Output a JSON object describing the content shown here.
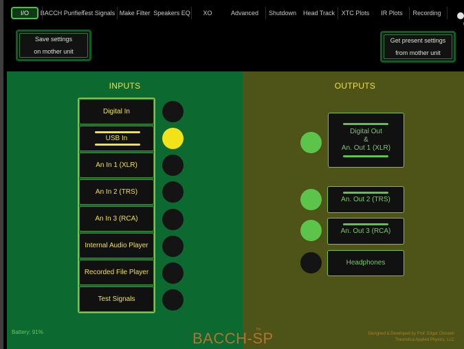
{
  "tabs": [
    {
      "label": "I/O",
      "active": true
    },
    {
      "label": "BACCH Purifier"
    },
    {
      "label": "Test Signals"
    },
    {
      "label": "Make Filter"
    },
    {
      "label": "Speakers EQ"
    },
    {
      "label": "XO"
    },
    {
      "label": "Advanced"
    },
    {
      "label": "Shutdown"
    },
    {
      "label": "Head Track"
    },
    {
      "label": "XTC Plots"
    },
    {
      "label": "IR Plots"
    },
    {
      "label": "Recording"
    }
  ],
  "corner_text": "0",
  "settings": {
    "save_line1": "Save settings",
    "save_line2": "on mother unit",
    "get_line1": "Get present settings",
    "get_line2": "from mother unit"
  },
  "inputs": {
    "title": "INPUTS",
    "items": [
      {
        "label": "Digital In",
        "selected": false
      },
      {
        "label": "USB In",
        "selected": true
      },
      {
        "label": "An In 1 (XLR)",
        "selected": false
      },
      {
        "label": "An In 2 (TRS)",
        "selected": false
      },
      {
        "label": "An In 3 (RCA)",
        "selected": false
      },
      {
        "label": "Internal Audio Player",
        "selected": false
      },
      {
        "label": "Recorded File Player",
        "selected": false
      },
      {
        "label": "Test Signals",
        "selected": false
      }
    ]
  },
  "outputs": {
    "title": "OUTPUTS",
    "items": [
      {
        "line1": "Digital Out",
        "line2": "&",
        "line3": "An. Out 1 (XLR)",
        "active": true
      },
      {
        "label": "An. Out 2 (TRS)",
        "active": true
      },
      {
        "label": "An. Out 3 (RCA)",
        "active": true
      },
      {
        "label": "Headphones",
        "active": false
      }
    ]
  },
  "footer": {
    "battery": "Battery: 91%",
    "brand": "BACCH-SP",
    "trademark": "TM",
    "credit_line1": "Designed & Developed by Prof. Edgar Choueiri",
    "credit_line2": "Theoretica Applied Physics, LLC"
  },
  "colors": {
    "inputs_panel": "#0c6a31",
    "outputs_panel": "#4e5418",
    "selected_led": "#f2e21a",
    "active_output_led": "#5cc44a",
    "input_text": "#f0e046",
    "brand": "#b2732e"
  }
}
